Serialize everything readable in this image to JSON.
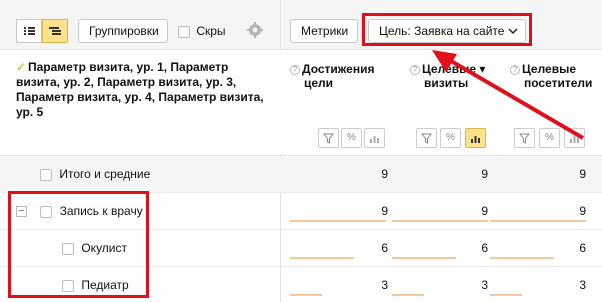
{
  "toolbar": {
    "groupings_label": "Группировки",
    "hide_label": "Скры",
    "metrics_label": "Метрики",
    "goal_label": "Цель: Заявка на сайте"
  },
  "header": {
    "dimension_title": "Параметр визита, ур. 1, Параметр визита, ур. 2, Параметр визита, ур. 3, Параметр визита, ур. 4, Параметр визита, ур. 5",
    "columns": [
      {
        "label_1": "Достижения",
        "label_2": "цели",
        "sort": ""
      },
      {
        "label_1": "Целевые",
        "label_2": "визиты",
        "sort": "▾"
      },
      {
        "label_1": "Целевые",
        "label_2": "посетители",
        "sort": ""
      }
    ],
    "filter_icon": "funnel-icon",
    "percent_icon": "percent-icon",
    "chart_icon": "bar-chart-icon"
  },
  "rows": [
    {
      "label": "Итого и средние",
      "values": [
        "9",
        "9",
        "9"
      ]
    },
    {
      "label": "Запись к врачу",
      "values": [
        "9",
        "9",
        "9"
      ],
      "bars": [
        1,
        1,
        1
      ]
    },
    {
      "label": "Окулист",
      "values": [
        "6",
        "6",
        "6"
      ],
      "bars": [
        0.667,
        0.667,
        0.667
      ]
    },
    {
      "label": "Педиатр",
      "values": [
        "3",
        "3",
        "3"
      ],
      "bars": [
        0.333,
        0.333,
        0.333
      ]
    }
  ],
  "colors": {
    "highlight": "#e0101a",
    "accent_yellow": "#ffe28a",
    "bar": "#f5c79a"
  }
}
